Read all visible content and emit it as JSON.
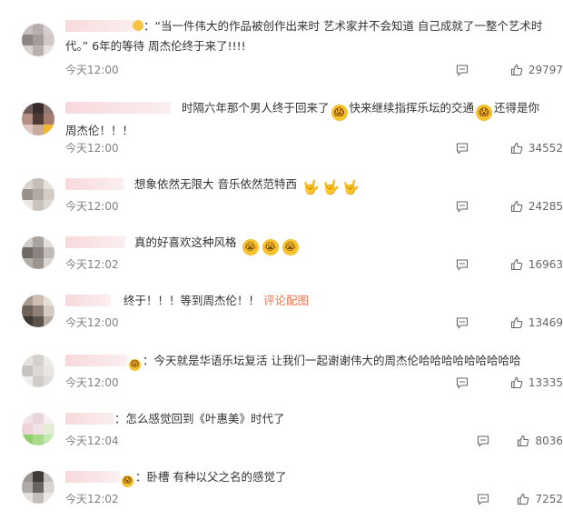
{
  "comments": [
    {
      "segments": [
        "：“当一件伟大的作品被创作出来时 艺术家并不会知道 自己成就了一整个艺术时代。” 6年的等待 周杰伦终于来了!!!!"
      ],
      "time": "今天12:00",
      "likes": "29797"
    },
    {
      "segments": [
        "时隔六年那个男人终于回来了",
        "快来继续指挥乐坛的交通",
        "还得是你周杰伦！！！"
      ],
      "time": "今天12:00",
      "likes": "34552"
    },
    {
      "segments": [
        "想象依然无限大 音乐依然范特西"
      ],
      "time": "今天12:00",
      "likes": "24285"
    },
    {
      "segments": [
        "真的好喜欢这种风格"
      ],
      "time": "今天12:02",
      "likes": "16963"
    },
    {
      "segments": [
        "终于！！！等到周杰伦！！"
      ],
      "link": "评论配图",
      "time": "今天12:00",
      "likes": "13469"
    },
    {
      "segments": [
        "：今天就是华语乐坛复活 让我们一起谢谢伟大的周杰伦哈哈哈哈哈哈哈哈哈"
      ],
      "time": "今天12:00",
      "likes": "13335"
    },
    {
      "segments": [
        "：怎么感觉回到《叶惠美》时代了"
      ],
      "time": "今天12:04",
      "likes": "8036"
    },
    {
      "segments": [
        "：卧槽 有种以父之名的感觉了"
      ],
      "time": "今天12:02",
      "likes": "7252"
    }
  ],
  "icons": {
    "reply": "comment-icon",
    "like": "thumbs-up-icon"
  },
  "colors": {
    "link": "#eb7350",
    "meta": "#808080",
    "text": "#333333"
  }
}
